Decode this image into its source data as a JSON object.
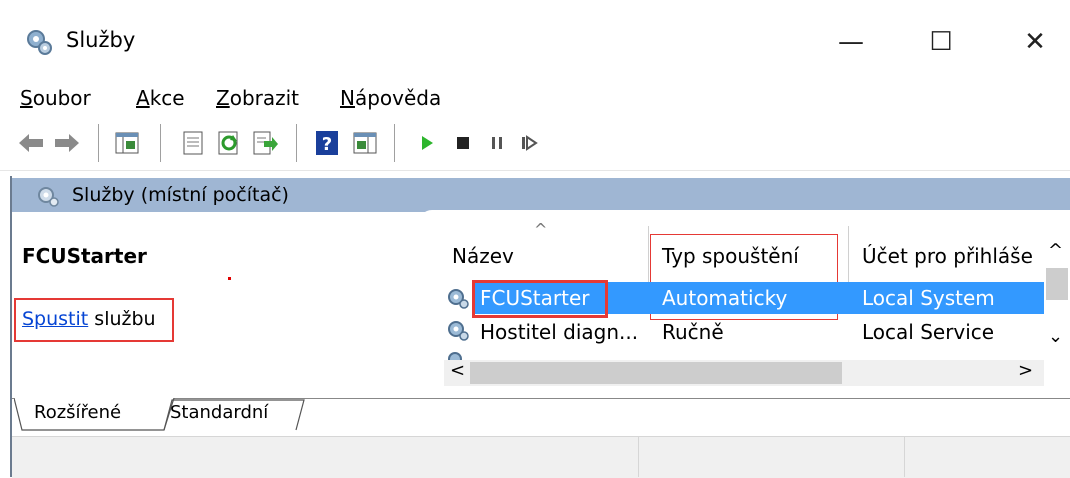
{
  "window": {
    "title": "Služby",
    "minimize_label": "—",
    "maximize_label": "☐",
    "close_label": "✕"
  },
  "menu": [
    {
      "underline": "S",
      "rest": "oubor"
    },
    {
      "underline": "A",
      "rest": "kce"
    },
    {
      "underline": "Z",
      "rest": "obrazit"
    },
    {
      "underline": "N",
      "rest": "ápověda"
    }
  ],
  "toolbar": {
    "icons": [
      "back-arrow-icon",
      "forward-arrow-icon",
      "console-tree-icon",
      "properties-icon",
      "refresh-icon",
      "export-list-icon",
      "help-icon",
      "show-hide-action-pane-icon",
      "play-icon",
      "stop-icon",
      "pause-icon",
      "restart-icon"
    ],
    "colors": {
      "play": "#2db52d",
      "stop": "#222222",
      "help": "#1a3f9b"
    }
  },
  "scope_pane": {
    "header": "Služby (místní počítač)"
  },
  "details": {
    "service_name": "FCUStarter",
    "start_link": "Spustit",
    "start_suffix": " službu"
  },
  "list": {
    "columns": [
      "Název",
      "Typ spouštění",
      "Účet pro přihláše"
    ],
    "sort_indicator": "^",
    "rows": [
      {
        "name": "FCUStarter",
        "startup": "Automaticky",
        "account": "Local System",
        "selected": true
      },
      {
        "name": "Hostitel diagn...",
        "startup": "Ručně",
        "account": "Local Service",
        "selected": false
      }
    ]
  },
  "scroll": {
    "up": "^",
    "down": "⌄",
    "left": "<",
    "right": ">"
  },
  "tabs": [
    "Rozšířené",
    "Standardní"
  ],
  "colors": {
    "header_bg": "#9fb6d3",
    "selection": "#3399ff",
    "highlight_box": "#e53935",
    "link": "#0645d4"
  }
}
